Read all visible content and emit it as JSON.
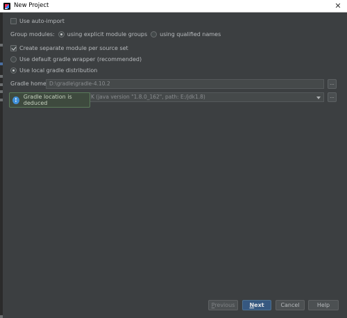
{
  "window": {
    "title": "New Project"
  },
  "options": {
    "auto_import": {
      "label": "Use auto-import",
      "checked": false
    },
    "group_modules": {
      "label": "Group modules:",
      "choices": [
        {
          "label": "using explicit module groups",
          "selected": true
        },
        {
          "label": "using qualified names",
          "selected": false
        }
      ]
    },
    "separate_module": {
      "label": "Create separate module per source set",
      "checked": true
    },
    "gradle_dist": {
      "choices": [
        {
          "label": "Use default gradle wrapper (recommended)",
          "selected": false
        },
        {
          "label": "Use local gradle distribution",
          "selected": true
        }
      ]
    }
  },
  "gradle_home": {
    "label": "Gradle home:",
    "value": "D:\\gradle\\gradle-4.10.2",
    "browse": "..."
  },
  "gradle_jvm": {
    "value": "K (java version \"1.8.0_162\", path: E:/jdk1.8)",
    "browse": "..."
  },
  "tooltip": {
    "text": "Gradle location is deduced",
    "icon": "info-icon"
  },
  "buttons": {
    "previous": {
      "first": "P",
      "rest": "revious"
    },
    "next": {
      "first": "N",
      "rest": "ext"
    },
    "cancel": "Cancel",
    "help": "Help"
  },
  "colors": {
    "primary_button": "#365880",
    "tooltip_bg": "#3e4a3e",
    "info_blue": "#3f8fd9"
  }
}
